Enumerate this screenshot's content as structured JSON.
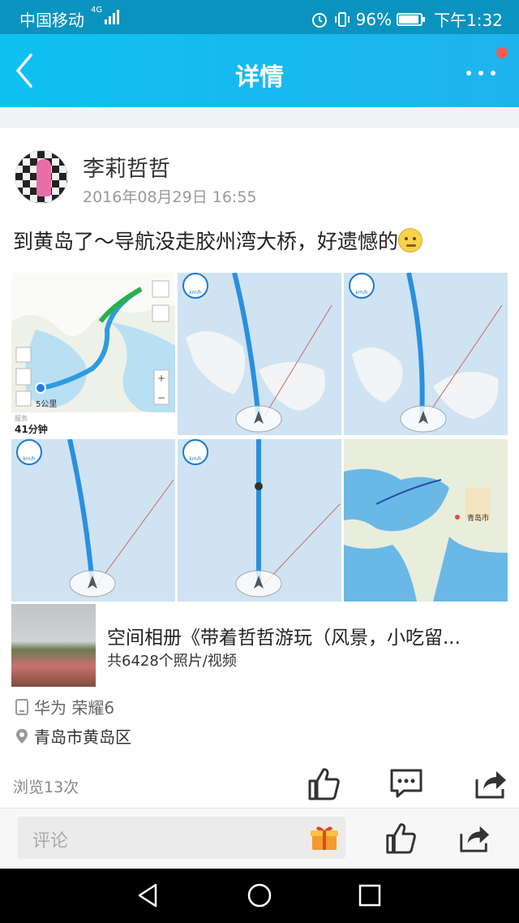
{
  "status_bar": {
    "carrier": "中国移动",
    "network": "4G",
    "battery": "96%",
    "time": "下午1:32"
  },
  "nav": {
    "title": "详情",
    "back_icon": "back-arrow-icon",
    "more_icon": "more-dots-icon",
    "notification_color": "#f45b4f",
    "accent": "#1bb6ef"
  },
  "post": {
    "author": "李莉哲哲",
    "date": "2016年08月29日 16:55",
    "text": "到黄岛了～导航没走胶州湾大桥，好遗憾的",
    "emoji": "worried-face-icon",
    "photos": [
      {
        "kind": "route-map",
        "scale_label": "5公里",
        "eta": "41分钟",
        "corner": "服务"
      },
      {
        "kind": "navigation",
        "badge": "km/h"
      },
      {
        "kind": "navigation",
        "badge": "km/h"
      },
      {
        "kind": "navigation",
        "badge": "km/h"
      },
      {
        "kind": "navigation",
        "badge": "km/h"
      },
      {
        "kind": "city-map",
        "label": "青岛市"
      }
    ]
  },
  "album": {
    "title": "空间相册《带着哲哲游玩（风景，小吃留...",
    "count": "共6428个照片/视频"
  },
  "device": "华为 荣耀6",
  "location": "青岛市黄岛区",
  "stats": {
    "views": "浏览13次"
  },
  "comment_bar": {
    "placeholder": "评论"
  }
}
